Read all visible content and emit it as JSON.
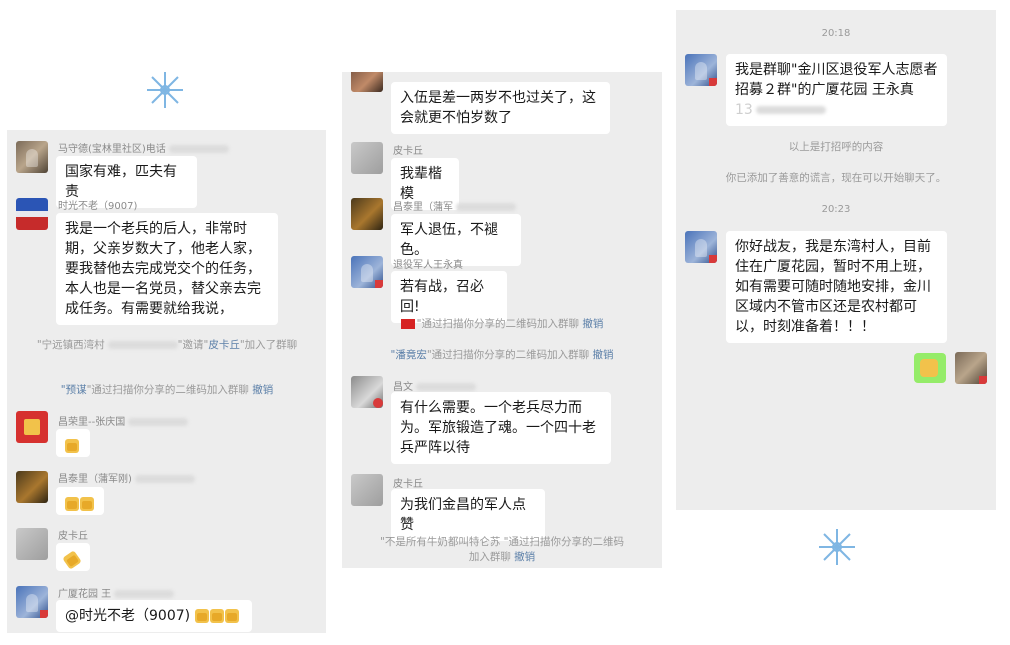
{
  "panel1": {
    "msg1": {
      "sender": "马守德(宝林里社区)电话",
      "text": "国家有难，匹夫有责"
    },
    "msg2": {
      "sender": "时光不老（9007)",
      "text": "我是一个老兵的后人，非常时期，父亲岁数大了，他老人家，要我替他去完成党交个的任务，本人也是一名党员，替父亲去完成任务。有需要就给我说，"
    },
    "sys1": {
      "pre": "\"宁远镇西湾村",
      "mid": "\"邀请\"",
      "name": "皮卡丘",
      "post": "\"加入了群聊"
    },
    "sys2": {
      "name": "预谋",
      "post": "\"通过扫描你分享的二维码加入群聊",
      "undo": "撤销"
    },
    "msg3": {
      "sender": "昌荣里--张庆国"
    },
    "msg4": {
      "sender": "昌泰里（蒲军刚)"
    },
    "msg5": {
      "sender": "皮卡丘"
    },
    "msg6": {
      "sender": "广厦花园 王",
      "text": "@时光不老（9007)"
    }
  },
  "panel2": {
    "msg1": {
      "text": "入伍是差一两岁不也过关了，这会就更不怕岁数了"
    },
    "msg2": {
      "sender": "皮卡丘",
      "text": "我辈楷模"
    },
    "msg3": {
      "sender": "昌泰里（蒲军",
      "text": "军人退伍，不褪色。"
    },
    "msg4": {
      "sender": "退役军人王永真",
      "text": "若有战，召必回!"
    },
    "sys1": {
      "post": "\"通过扫描你分享的二维码加入群聊",
      "undo": "撤销"
    },
    "sys2": {
      "name": "潘竟宏",
      "post": "\"通过扫描你分享的二维码加入群聊",
      "undo": "撤销"
    },
    "msg5": {
      "sender": "昌文",
      "text": "有什么需要。一个老兵尽力而为。军旅锻造了魂。一个四十老兵严阵以待"
    },
    "msg6": {
      "sender": "皮卡丘",
      "text": "为我们金昌的军人点赞"
    },
    "sys3": {
      "line1": "\"不是所有牛奶都叫特仑苏",
      "line1b": "\"通过扫描你分享的二维码",
      "line2": "加入群聊",
      "undo": "撤销"
    }
  },
  "panel3": {
    "time1": "20:18",
    "msg1": {
      "text": "我是群聊\"金川区退役军人志愿者招募２群\"的广厦花园 王永真",
      "tail": "13"
    },
    "sys1": "以上是打招呼的内容",
    "sys2": "你已添加了善意的谎言，现在可以开始聊天了。",
    "time2": "20:23",
    "msg2": {
      "text": "你好战友，我是东湾村人，目前住在广厦花园，暂时不用上班，如有需要可随时随地安排，金川区域内不管市区还是农村都可以，时刻准备着！！！"
    }
  },
  "colors": {
    "panel_bg": "#ededed",
    "bubble": "#ffffff",
    "self_bubble": "#95ec69",
    "link": "#5b7fa8"
  },
  "icons": [
    "snowflake-icon",
    "thumbs-up-emoji",
    "flag-emoji",
    "fist-emoji"
  ]
}
